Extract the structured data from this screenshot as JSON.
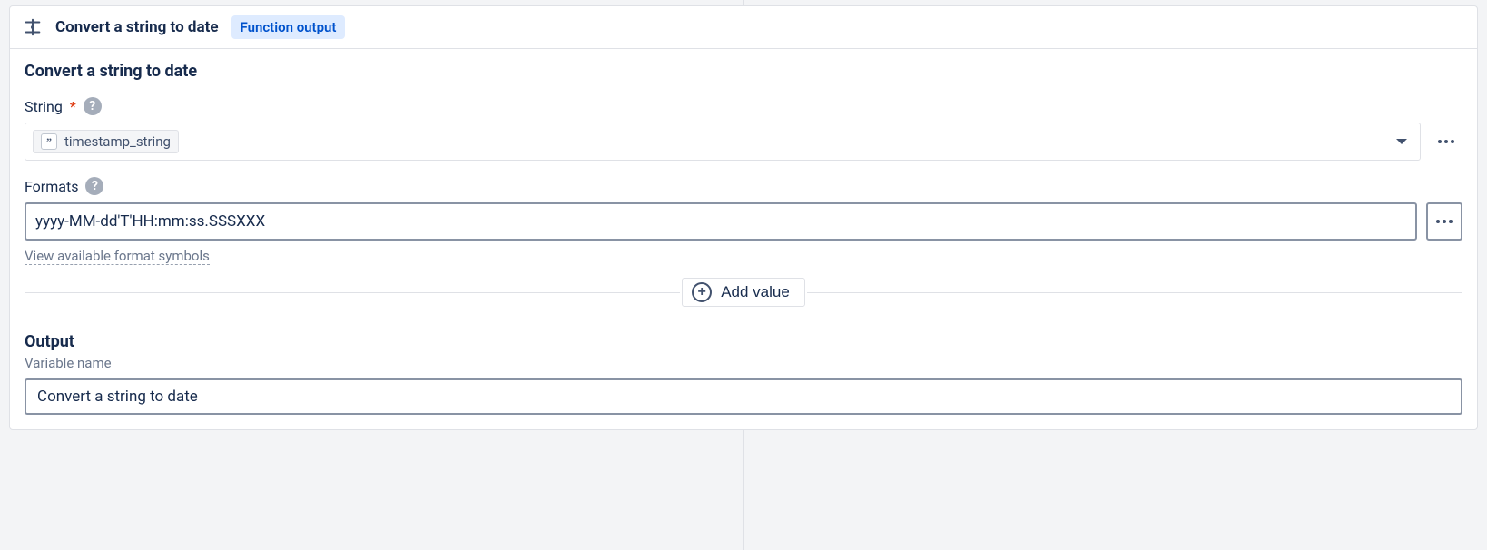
{
  "header": {
    "title": "Convert a string to date",
    "badge": "Function output"
  },
  "body": {
    "section_title": "Convert a string to date",
    "string_field": {
      "label": "String",
      "required_marker": "*",
      "chip_label": "timestamp_string"
    },
    "formats_field": {
      "label": "Formats",
      "value": "yyyy-MM-dd'T'HH:mm:ss.SSSXXX",
      "link_text": "View available format symbols"
    },
    "add_value_label": "Add value",
    "output": {
      "title": "Output",
      "sublabel": "Variable name",
      "value": "Convert a string to date"
    }
  }
}
